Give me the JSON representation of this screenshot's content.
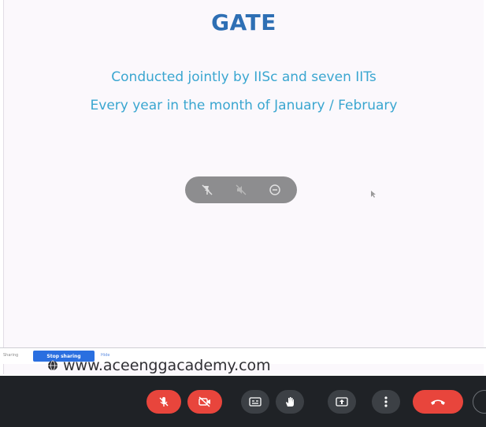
{
  "slide": {
    "title": "GATE",
    "line1": "Conducted jointly by IISc and seven IITs",
    "line2": "Every year in the month of January / February"
  },
  "presenter_overlay": {
    "icons": [
      "pin-off-icon",
      "mute-off-icon",
      "remove-icon"
    ]
  },
  "share_bar": {
    "label": "Sharing",
    "stop_label": "Stop sharing",
    "hide_label": "Hide"
  },
  "watermark": {
    "text": "www.aceenggacademy.com"
  },
  "toolbar": {
    "buttons": [
      {
        "icon": "mic-off-icon",
        "color": "#e8453c"
      },
      {
        "icon": "camera-off-icon",
        "color": "#e8453c"
      },
      {
        "icon": "captions-icon",
        "color": "#3c4045"
      },
      {
        "icon": "raise-hand-icon",
        "color": "#3c4045"
      },
      {
        "icon": "present-screen-icon",
        "color": "#3c4045"
      },
      {
        "icon": "more-options-icon",
        "color": "#3c4045"
      },
      {
        "icon": "end-call-icon",
        "color": "#e8453c"
      }
    ]
  }
}
